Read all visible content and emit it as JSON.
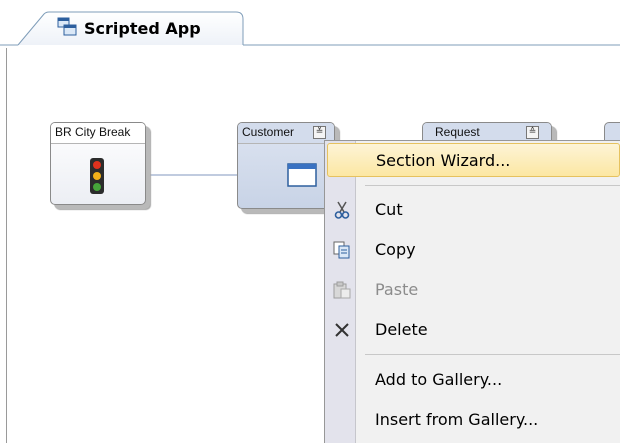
{
  "tab": {
    "label": "Scripted App"
  },
  "nodes": [
    {
      "title": "BR City Break",
      "icon": "traffic-light-icon"
    },
    {
      "title": "Customer",
      "icon": "window-icon",
      "toggle": "≚"
    },
    {
      "title": "Request",
      "icon": "",
      "toggle": "≙"
    }
  ],
  "context_menu": {
    "items": [
      {
        "label": "Section Wizard...",
        "icon": "",
        "state": "highlighted"
      },
      {
        "label": "Cut",
        "icon": "scissors-icon",
        "state": "enabled"
      },
      {
        "label": "Copy",
        "icon": "copy-icon",
        "state": "enabled"
      },
      {
        "label": "Paste",
        "icon": "paste-icon",
        "state": "disabled"
      },
      {
        "label": "Delete",
        "icon": "delete-x-icon",
        "state": "enabled"
      },
      {
        "label": "Add to Gallery...",
        "icon": "",
        "state": "enabled"
      },
      {
        "label": "Insert from Gallery...",
        "icon": "",
        "state": "enabled"
      }
    ]
  }
}
